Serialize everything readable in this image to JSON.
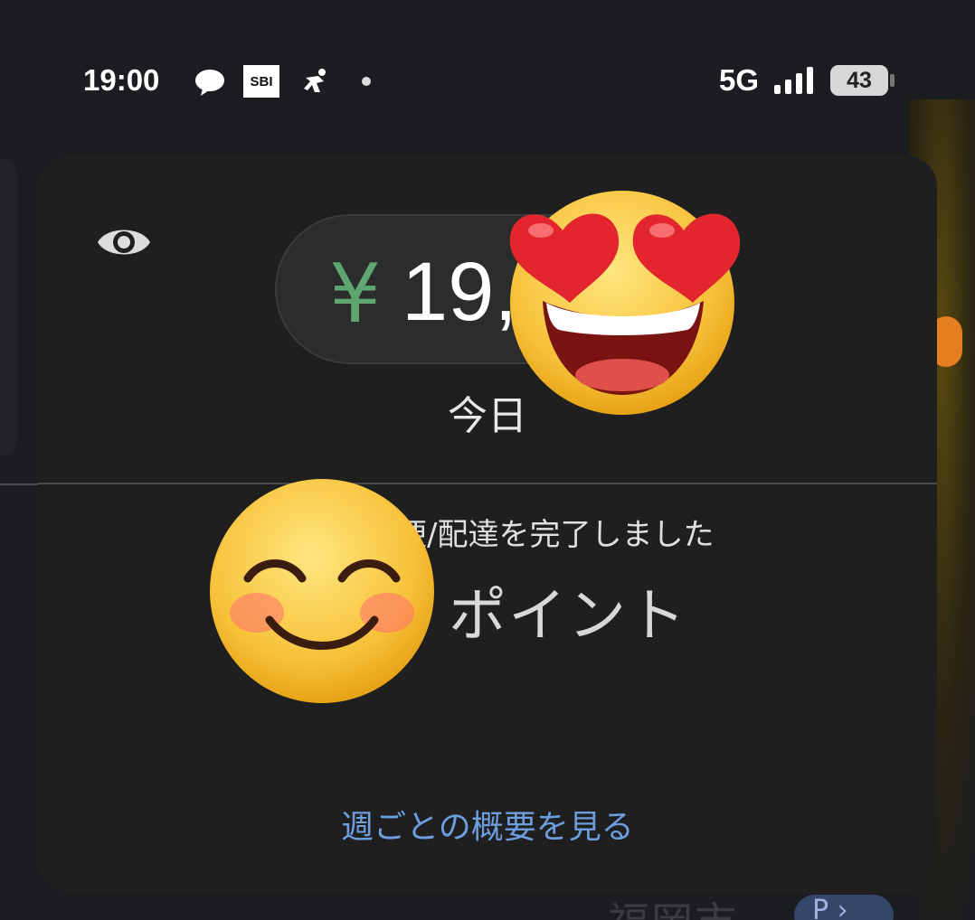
{
  "status_bar": {
    "time": "19:00",
    "icons": [
      "message-bubble-icon",
      "sbi-app-icon",
      "delivery-runner-icon",
      "dot-icon"
    ],
    "sbi_label": "SBI",
    "network": "5G",
    "battery": "43"
  },
  "card": {
    "currency_symbol": "¥",
    "amount": "19,",
    "period": "今日",
    "trips_text": "便/配達を完了しました",
    "points_text": "ポイント",
    "weekly_link": "週ごとの概要を見る"
  },
  "map": {
    "bottom_text": "福岡市",
    "badge": "P ›"
  },
  "stickers": [
    "heart-eyes-emoji",
    "smiling-face-emoji"
  ],
  "colors": {
    "background": "#1b1d21",
    "card": "#1f1f1f",
    "currency": "#5fa56f",
    "link": "#6d9ee0"
  }
}
